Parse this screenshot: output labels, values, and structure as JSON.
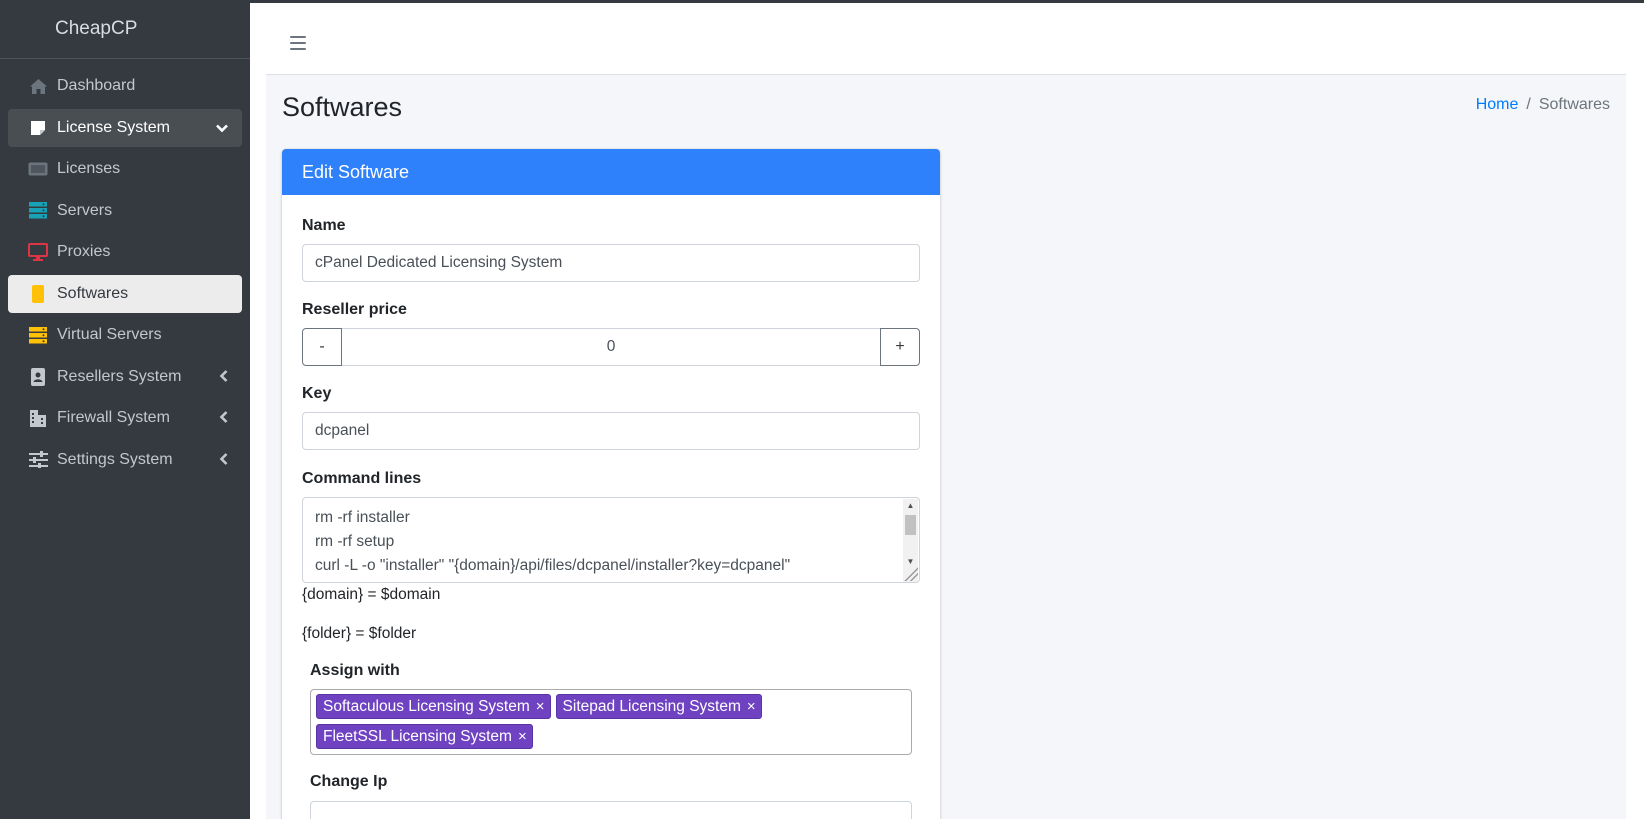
{
  "brand": "CheapCP",
  "sidebar": {
    "items": [
      {
        "label": "Dashboard",
        "icon": "home-icon"
      },
      {
        "label": "License System",
        "icon": "sticky-note-icon"
      },
      {
        "label": "Licenses",
        "icon": "license-card-icon"
      },
      {
        "label": "Servers",
        "icon": "server-icon"
      },
      {
        "label": "Proxies",
        "icon": "monitor-icon"
      },
      {
        "label": "Softwares",
        "icon": "mobile-icon"
      },
      {
        "label": "Virtual Servers",
        "icon": "virtual-server-icon"
      },
      {
        "label": "Resellers System",
        "icon": "id-badge-icon"
      },
      {
        "label": "Firewall System",
        "icon": "building-icon"
      },
      {
        "label": "Settings System",
        "icon": "sliders-icon"
      }
    ]
  },
  "colors": {
    "sidebar_bg": "#343a40",
    "card_header": "#2f80fb",
    "chip": "#6f42c1",
    "link": "#007bff"
  },
  "page": {
    "title": "Softwares"
  },
  "breadcrumb": {
    "home": "Home",
    "separator": "/",
    "current": "Softwares"
  },
  "form": {
    "header": "Edit Software",
    "name_label": "Name",
    "name_value": "cPanel Dedicated Licensing System",
    "price_label": "Reseller price",
    "price_minus": "-",
    "price_value": "0",
    "price_plus": "+",
    "key_label": "Key",
    "key_value": "dcpanel",
    "commands_label": "Command lines",
    "command_lines": [
      "rm -rf installer",
      "rm -rf setup",
      "curl -L -o \"installer\" \"{domain}/api/files/dcpanel/installer?key=dcpanel\""
    ],
    "note_domain": "{domain} = $domain",
    "note_folder": "{folder} = $folder",
    "assign_label": "Assign with",
    "assigned": [
      "Softaculous Licensing System",
      "Sitepad Licensing System",
      "FleetSSL Licensing System"
    ],
    "chip_remove": "×",
    "change_ip_label": "Change Ip"
  }
}
